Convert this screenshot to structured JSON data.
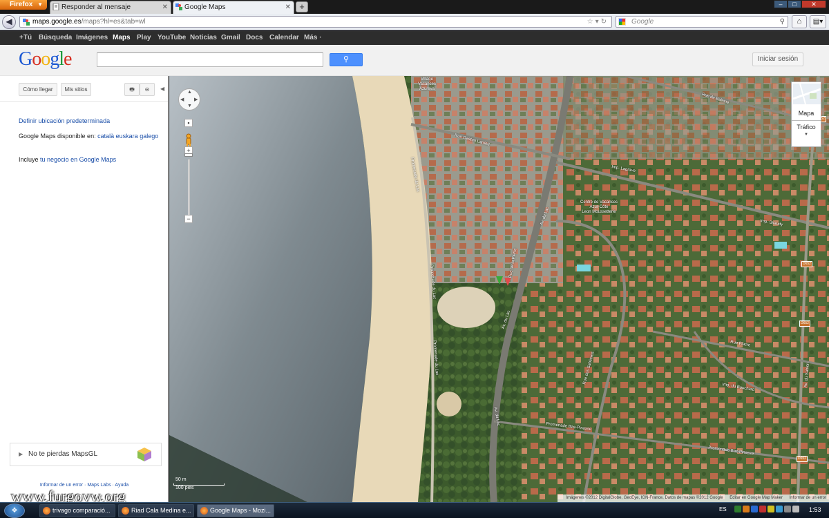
{
  "browser": {
    "firefox_button": "Firefox",
    "tabs": [
      {
        "title": "Responder al mensaje"
      },
      {
        "title": "Google Maps"
      }
    ],
    "url_domain": "maps.google.es",
    "url_path": "/maps?hl=es&tab=wl",
    "search_placeholder": "Google",
    "new_tab": "+"
  },
  "gbar": {
    "links": [
      "+Tú",
      "Búsqueda",
      "Imágenes",
      "Maps",
      "Play",
      "YouTube",
      "Noticias",
      "Gmail",
      "Docs",
      "Calendar",
      "Más ·"
    ],
    "selected": "Maps"
  },
  "header": {
    "logo": "Google",
    "search_value": "",
    "signin": "Iniciar sesión"
  },
  "panel": {
    "directions_btn": "Cómo llegar",
    "my_places_btn": "Mis sitios",
    "default_location_link": "Definir ubicación predeterminada",
    "available_in_prefix": "Google Maps disponible en:",
    "languages": [
      "català",
      "euskara",
      "galego"
    ],
    "business_prefix": "Incluye",
    "business_link": "tu negocio en Google Maps",
    "mapsgl_promo": "No te pierdas MapsGL",
    "footer_links": "Informar de un error · Maps Labs · Ayuda"
  },
  "map": {
    "maptype_label": "Mapa",
    "traffic_label": "Tráfico",
    "scale_metric": "50 m",
    "scale_imperial": "100 pies",
    "attribution": "Imágenes ©2012 DigitalGlobe, GeoEye, IGN-France, Datos de mapas ©2012 Google",
    "edit_link": "Editar en Google Map Maker",
    "report_link": "Informar de un error",
    "labels": {
      "village": "Village\nVacances\nAzureva",
      "centre": "Centre de Vacances\nAzur-Côte\nLeon Moussetterie",
      "rue_lesbats": "Rue Gaston Larrieu",
      "rue_pierre": "Rue de la Pierre",
      "imp_lagrave": "Imp. Lagrave",
      "imp_baleine": "Rue de Baleine",
      "imp_stiaudy": "Imp. Stiaudy",
      "promenade_lac": "Promenade du Lac",
      "promenade_lac2": "Promenade du Lac",
      "promenade_lac3": "Promenade du Lac",
      "promenade_bas": "Promenade Bas-Pinasse",
      "promenade_bas2": "Promenade Bas-Pinasse",
      "av_lac": "Av. du Lac",
      "av_lac2": "Av. du Lac",
      "av_lac3": "Av. du Lac",
      "rue_sablieres": "Rue des Sablières",
      "rue_d652": "Av. du Sablon",
      "rue_bouchard": "Imp. du Bouchard",
      "rue_fiacre": "Rue Fiacre",
      "shields": [
        "D652",
        "D652",
        "D652",
        "D652"
      ]
    }
  },
  "taskbar": {
    "buttons": [
      "trivago comparació...",
      "Riad Cala Medina e...",
      "Google Maps - Mozi..."
    ],
    "language": "ES",
    "clock": "1:53"
  },
  "watermark": "www.furgovw.org"
}
